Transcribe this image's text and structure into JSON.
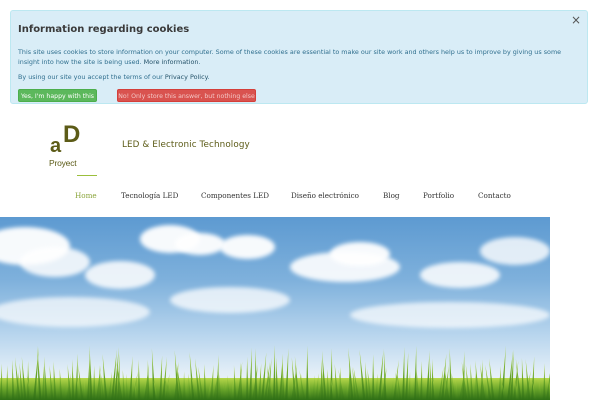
{
  "cookie_banner": {
    "title": "Information regarding cookies",
    "close_label": "×",
    "text_main": "This site uses cookies to store information on your computer. Some of these cookies are essential to make our site work and others help us to improve by giving us some insight into how the site is being used.",
    "more_info_link": "More information",
    "terms_prefix": "By using our site you accept the terms of our",
    "privacy_link": "Privacy Policy",
    "yes_button": "Yes, I'm happy with this",
    "no_button": "No! Only store this answer, but nothing else"
  },
  "header": {
    "logo_a": "a",
    "logo_d": "D",
    "logo_sub": "Proyect",
    "tagline": "LED & Electronic Technology"
  },
  "nav": {
    "items": [
      {
        "label": "Home",
        "active": true
      },
      {
        "label": "Tecnología LED",
        "active": false
      },
      {
        "label": "Componentes LED",
        "active": false
      },
      {
        "label": "Diseño electrónico",
        "active": false
      },
      {
        "label": "Blog",
        "active": false
      },
      {
        "label": "Portfolio",
        "active": false
      },
      {
        "label": "Contacto",
        "active": false
      }
    ]
  },
  "colors": {
    "banner_bg": "#d9edf7",
    "brand_olive": "#5c5b17",
    "nav_active": "#8aa43a",
    "button_yes": "#5cb85c",
    "button_no": "#d9534f"
  }
}
